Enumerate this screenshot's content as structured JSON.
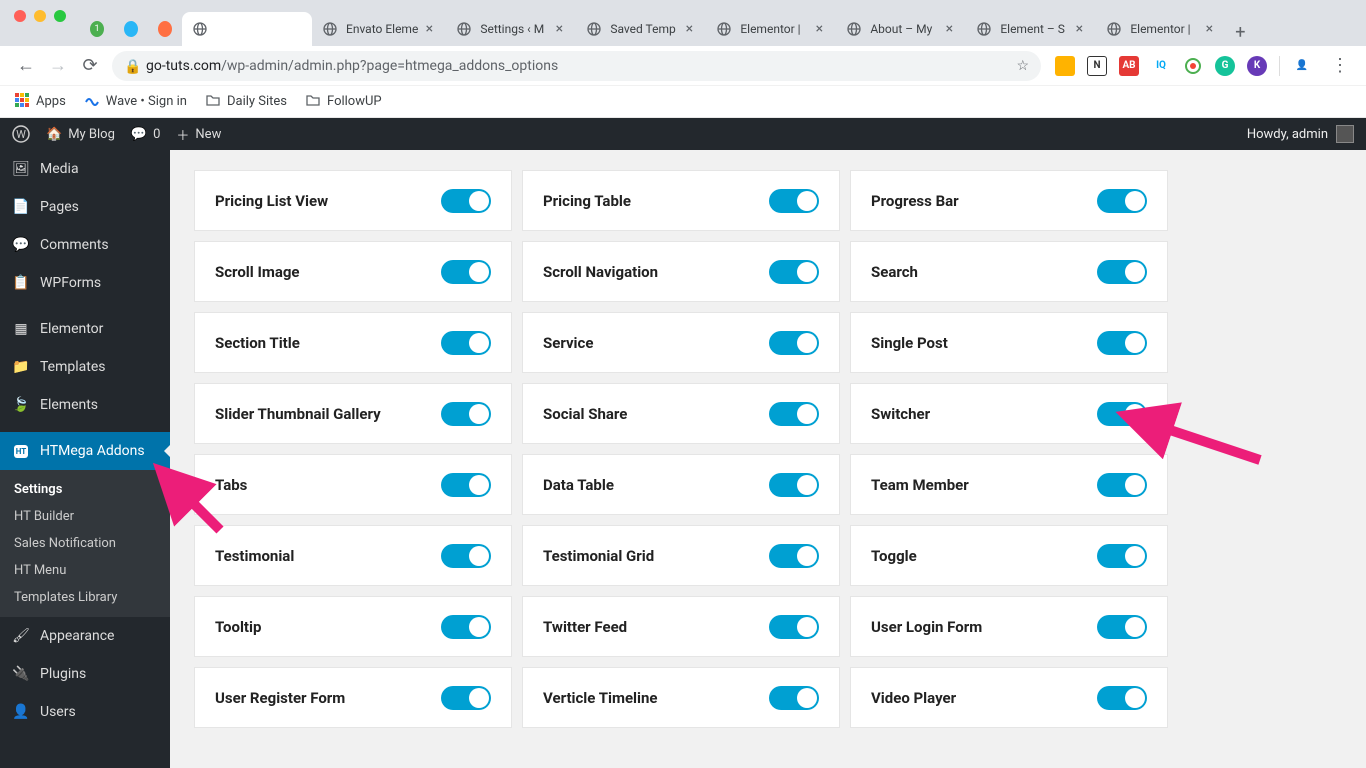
{
  "browser": {
    "tabs": [
      {
        "favicon": "#4caf50",
        "title": "",
        "badge": "1"
      },
      {
        "favicon": "#29b6f6",
        "title": ""
      },
      {
        "favicon": "#ff7043",
        "title": ""
      },
      {
        "favicon": "#9e9e9e",
        "title": "",
        "active": true
      },
      {
        "favicon": "#9e9e9e",
        "title": "Envato Eleme"
      },
      {
        "favicon": "#9e9e9e",
        "title": "Settings ‹ M"
      },
      {
        "favicon": "#9e9e9e",
        "title": "Saved Temp"
      },
      {
        "favicon": "#9e9e9e",
        "title": "Elementor | "
      },
      {
        "favicon": "#9e9e9e",
        "title": "About – My "
      },
      {
        "favicon": "#42a5f5",
        "title": "Element – S"
      },
      {
        "favicon": "#9e9e9e",
        "title": "Elementor | "
      }
    ],
    "url_host": "go-tuts.com",
    "url_path": "/wp-admin/admin.php?page=htmega_addons_options",
    "bookmarks": [
      {
        "icon": "apps",
        "label": "Apps"
      },
      {
        "icon": "wave",
        "label": "Wave • Sign in"
      },
      {
        "icon": "folder",
        "label": "Daily Sites"
      },
      {
        "icon": "folder",
        "label": "FollowUP"
      }
    ]
  },
  "wp_admin_bar": {
    "site_name": "My Blog",
    "comments": "0",
    "new_label": "New",
    "howdy": "Howdy, admin"
  },
  "sidebar": {
    "items": [
      {
        "icon": "media",
        "label": "Media"
      },
      {
        "icon": "page",
        "label": "Pages"
      },
      {
        "icon": "comment",
        "label": "Comments"
      },
      {
        "icon": "form",
        "label": "WPForms"
      },
      {
        "sep": true
      },
      {
        "icon": "elementor",
        "label": "Elementor"
      },
      {
        "icon": "template",
        "label": "Templates"
      },
      {
        "icon": "leaf",
        "label": "Elements"
      },
      {
        "sep": true
      },
      {
        "icon": "ht",
        "label": "HTMega Addons",
        "active": true
      }
    ],
    "submenu": [
      {
        "label": "Settings",
        "current": true
      },
      {
        "label": "HT Builder"
      },
      {
        "label": "Sales Notification"
      },
      {
        "label": "HT Menu"
      },
      {
        "label": "Templates Library"
      }
    ],
    "items2": [
      {
        "icon": "brush",
        "label": "Appearance"
      },
      {
        "icon": "plugin",
        "label": "Plugins"
      },
      {
        "icon": "user",
        "label": "Users"
      }
    ]
  },
  "addons": [
    {
      "label": "Pricing List View",
      "enabled": true
    },
    {
      "label": "Pricing Table",
      "enabled": true
    },
    {
      "label": "Progress Bar",
      "enabled": true
    },
    {
      "label": "Scroll Image",
      "enabled": true
    },
    {
      "label": "Scroll Navigation",
      "enabled": true
    },
    {
      "label": "Search",
      "enabled": true
    },
    {
      "label": "Section Title",
      "enabled": true
    },
    {
      "label": "Service",
      "enabled": true
    },
    {
      "label": "Single Post",
      "enabled": true
    },
    {
      "label": "Slider Thumbnail Gallery",
      "enabled": true
    },
    {
      "label": "Social Share",
      "enabled": true
    },
    {
      "label": "Switcher",
      "enabled": true
    },
    {
      "label": "Tabs",
      "enabled": true
    },
    {
      "label": "Data Table",
      "enabled": true
    },
    {
      "label": "Team Member",
      "enabled": true
    },
    {
      "label": "Testimonial",
      "enabled": true
    },
    {
      "label": "Testimonial Grid",
      "enabled": true
    },
    {
      "label": "Toggle",
      "enabled": true
    },
    {
      "label": "Tooltip",
      "enabled": true
    },
    {
      "label": "Twitter Feed",
      "enabled": true
    },
    {
      "label": "User Login Form",
      "enabled": true
    },
    {
      "label": "User Register Form",
      "enabled": true
    },
    {
      "label": "Verticle Timeline",
      "enabled": true
    },
    {
      "label": "Video Player",
      "enabled": true
    }
  ]
}
